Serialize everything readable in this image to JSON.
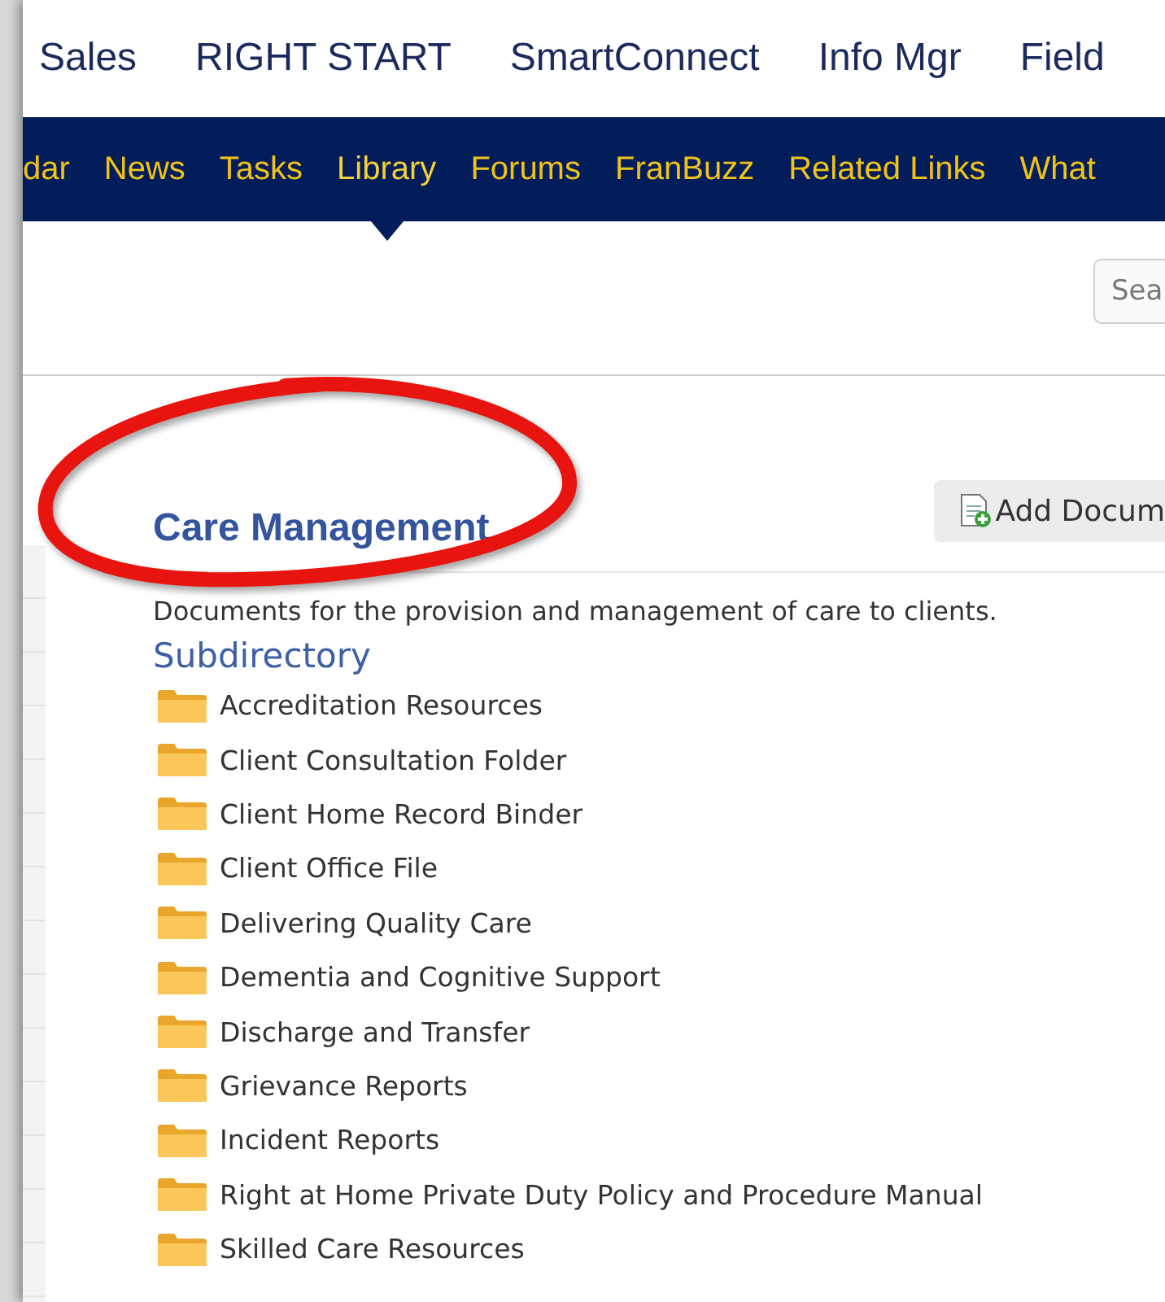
{
  "top_nav": [
    {
      "label": "Sales"
    },
    {
      "label": "RIGHT START"
    },
    {
      "label": "SmartConnect"
    },
    {
      "label": "Info Mgr"
    },
    {
      "label": "Field"
    }
  ],
  "tabs": [
    {
      "label": "dar",
      "selected": false
    },
    {
      "label": "News",
      "selected": false
    },
    {
      "label": "Tasks",
      "selected": false
    },
    {
      "label": "Library",
      "selected": true
    },
    {
      "label": "Forums",
      "selected": false
    },
    {
      "label": "FranBuzz",
      "selected": false
    },
    {
      "label": "Related Links",
      "selected": false
    },
    {
      "label": "What",
      "selected": false
    }
  ],
  "search": {
    "placeholder": "Sea"
  },
  "section": {
    "title": "Care Management",
    "add_button": "Add Docum",
    "description": "Documents for the provision and management of care to clients.",
    "subdirectory_label": "Subdirectory"
  },
  "folders": [
    {
      "name": "Accreditation Resources"
    },
    {
      "name": "Client Consultation Folder"
    },
    {
      "name": "Client Home Record Binder"
    },
    {
      "name": "Client Office File"
    },
    {
      "name": "Delivering Quality Care"
    },
    {
      "name": "Dementia and Cognitive Support"
    },
    {
      "name": "Discharge and Transfer"
    },
    {
      "name": "Grievance Reports"
    },
    {
      "name": "Incident Reports"
    },
    {
      "name": "Right at Home Private Duty Policy and Procedure Manual"
    },
    {
      "name": "Skilled Care Resources"
    }
  ]
}
